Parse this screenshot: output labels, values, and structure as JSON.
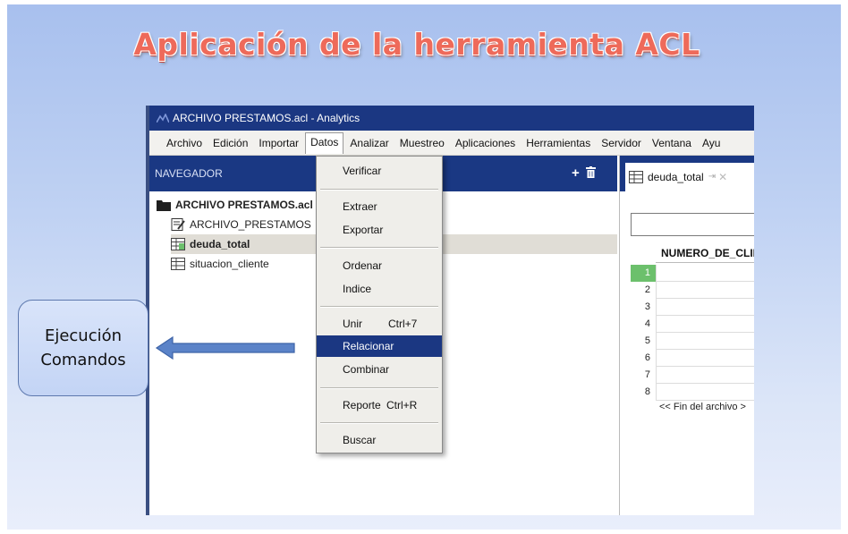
{
  "slide": {
    "title": "Aplicación de la herramienta ACL"
  },
  "window": {
    "title": "ARCHIVO PRESTAMOS.acl - Analytics"
  },
  "menubar": {
    "items": [
      "Archivo",
      "Edición",
      "Importar",
      "Datos",
      "Analizar",
      "Muestreo",
      "Aplicaciones",
      "Herramientas",
      "Servidor",
      "Ventana",
      "Ayu"
    ],
    "active": "Datos"
  },
  "navigator": {
    "header": "NAVEGADOR",
    "project": "ARCHIVO PRESTAMOS.acl",
    "items": [
      {
        "label": "ARCHIVO_PRESTAMOS",
        "icon": "script-icon"
      },
      {
        "label": "deuda_total",
        "icon": "table-icon",
        "selected": true
      },
      {
        "label": "situacion_cliente",
        "icon": "table-icon"
      }
    ]
  },
  "dropdown": {
    "items": [
      {
        "label": "Verificar"
      },
      {
        "label": "Extraer"
      },
      {
        "label": "Exportar"
      },
      {
        "label": "Ordenar"
      },
      {
        "label": "Indice"
      },
      {
        "label": "Unir",
        "shortcut": "Ctrl+7"
      },
      {
        "label": "Relacionar",
        "highlighted": true
      },
      {
        "label": "Combinar"
      },
      {
        "label": "Reporte",
        "shortcut": "Ctrl+R"
      },
      {
        "label": "Buscar"
      }
    ]
  },
  "view": {
    "tab_label": "deuda_total",
    "column_header": "NUMERO_DE_CLIEN",
    "rows": [
      "1",
      "2",
      "3",
      "4",
      "5",
      "6",
      "7",
      "8"
    ],
    "current_row": "1",
    "eof_text": "<< Fin del archivo >"
  },
  "callout": {
    "line1": "Ejecución",
    "line2": "Comandos"
  },
  "colors": {
    "title_red": "#ee6a5a",
    "titlebar_blue": "#1b3782",
    "highlight_blue": "#1b3782",
    "current_row_green": "#6cc06c"
  }
}
